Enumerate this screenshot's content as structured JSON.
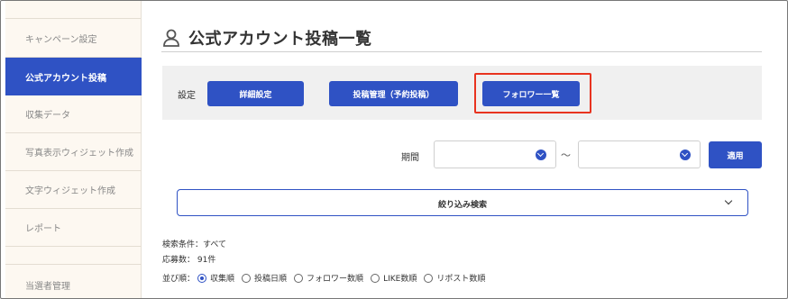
{
  "sidebar": {
    "items": [
      {
        "label": "キャンペーン設定"
      },
      {
        "label": "公式アカウント投稿"
      },
      {
        "label": "収集データ"
      },
      {
        "label": "写真表示ウィジェット作成"
      },
      {
        "label": "文字ウィジェット作成"
      },
      {
        "label": "レポート"
      },
      {
        "label": "当選者管理"
      }
    ],
    "active_index": 1
  },
  "page": {
    "title": "公式アカウント投稿一覧",
    "title_icon": "user-icon"
  },
  "settings": {
    "label": "設定",
    "buttons": {
      "detail": "詳細設定",
      "post_manage": "投稿管理（予約投稿）",
      "follower_list": "フォロワー一覧"
    }
  },
  "period": {
    "label": "期間",
    "start_value": "",
    "end_value": "",
    "separator": "〜",
    "apply_label": "適用"
  },
  "filter": {
    "label": "絞り込み検索"
  },
  "info": {
    "conditions": "検索条件：すべて",
    "entries": "応募数： 91件"
  },
  "sort": {
    "label": "並び順：",
    "options": [
      "収集順",
      "投稿日順",
      "フォロワー数順",
      "LIKE数順",
      "リポスト数順"
    ],
    "selected_index": 0
  },
  "colors": {
    "accent": "#2f52c4",
    "highlight": "#e8331f",
    "sidebar_bg": "#fdf8f1",
    "panel_bg": "#f0f0f0"
  }
}
